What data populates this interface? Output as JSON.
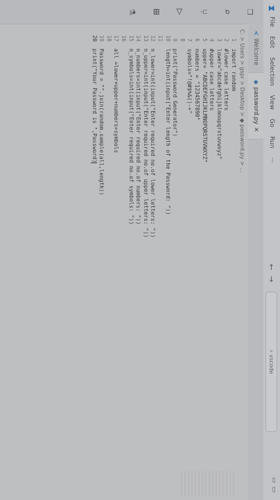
{
  "titlebar": {
    "menu": [
      "File",
      "Edit",
      "Selection",
      "View",
      "Go",
      "Run",
      "···"
    ],
    "search": "vscode"
  },
  "tabs": [
    {
      "label": "Welcome",
      "active": false
    },
    {
      "label": "password.py",
      "active": true
    }
  ],
  "breadcrumb": "C: > Users > gspr > Desktop > ◆ password.py > ...",
  "activity_icons": [
    "explorer-icon",
    "search-icon",
    "source-control-icon",
    "run-debug-icon",
    "extensions-icon",
    "testing-icon"
  ],
  "code": {
    "lines": [
      {
        "n": "1",
        "text": "import random"
      },
      {
        "n": "2",
        "text": "#lower case letters"
      },
      {
        "n": "3",
        "text": "lower=\"abcdefghijklmnopqrstuvwxyz\""
      },
      {
        "n": "4",
        "text": "#upper case letters"
      },
      {
        "n": "5",
        "text": "upper= \"ABCDEFGHIJKLMNOPQRSTUVWXYZ\""
      },
      {
        "n": "6",
        "text": "numbers = \"1234567890\""
      },
      {
        "n": "7",
        "text": "symbols=\"!@#$%&()-+\""
      },
      {
        "n": "8",
        "text": ""
      },
      {
        "n": "9",
        "text": "print(\"Password Generator\")"
      },
      {
        "n": "10",
        "text": "length=int(input(\"Enter length of the Password: \"))"
      },
      {
        "n": "11",
        "text": ""
      },
      {
        "n": "12",
        "text": "n_lower=int(input(\"Enter required no.of lower letters: \"))"
      },
      {
        "n": "13",
        "text": "n_upper=int(input(\"Enter required no.of upper letters: \"))"
      },
      {
        "n": "14",
        "text": "n_numbers=int(input(\"Enter required no.of numbers: \"))"
      },
      {
        "n": "15",
        "text": "n_symbols=int(input(\"Enter required no.of symbols: \"))"
      },
      {
        "n": "16",
        "text": ""
      },
      {
        "n": "17",
        "text": "all =lower+upper+numbers+symbols"
      },
      {
        "n": "18",
        "text": ""
      },
      {
        "n": "19",
        "text": "Password = \"\".join(random.sample(all,length))"
      },
      {
        "n": "20",
        "text": "print(\"Your Password is \",Password)"
      }
    ]
  }
}
